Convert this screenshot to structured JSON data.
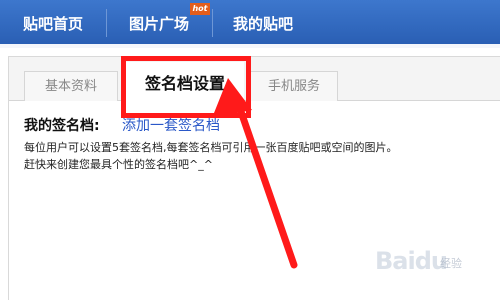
{
  "nav": {
    "items": [
      "贴吧首页",
      "图片广场",
      "我的贴吧"
    ],
    "hot_badge": "hot"
  },
  "tabs": {
    "basic_info": "基本资料",
    "signature_settings": "签名档设置",
    "mobile_service": "手机服务"
  },
  "signature": {
    "title": "我的签名档:",
    "add_link": "添加一套签名档",
    "description_lines": [
      "每位用户可以设置5套签名档,每套签名档可引用一张百度贴吧或空间的图片。",
      "赶快来创建您最具个性的签名档吧^_^"
    ]
  },
  "watermark": {
    "brand": "Baidu",
    "sub": "经验"
  },
  "colors": {
    "nav_bar": "#2f67be",
    "highlight": "#ff1a1a",
    "link": "#2a58c8"
  }
}
